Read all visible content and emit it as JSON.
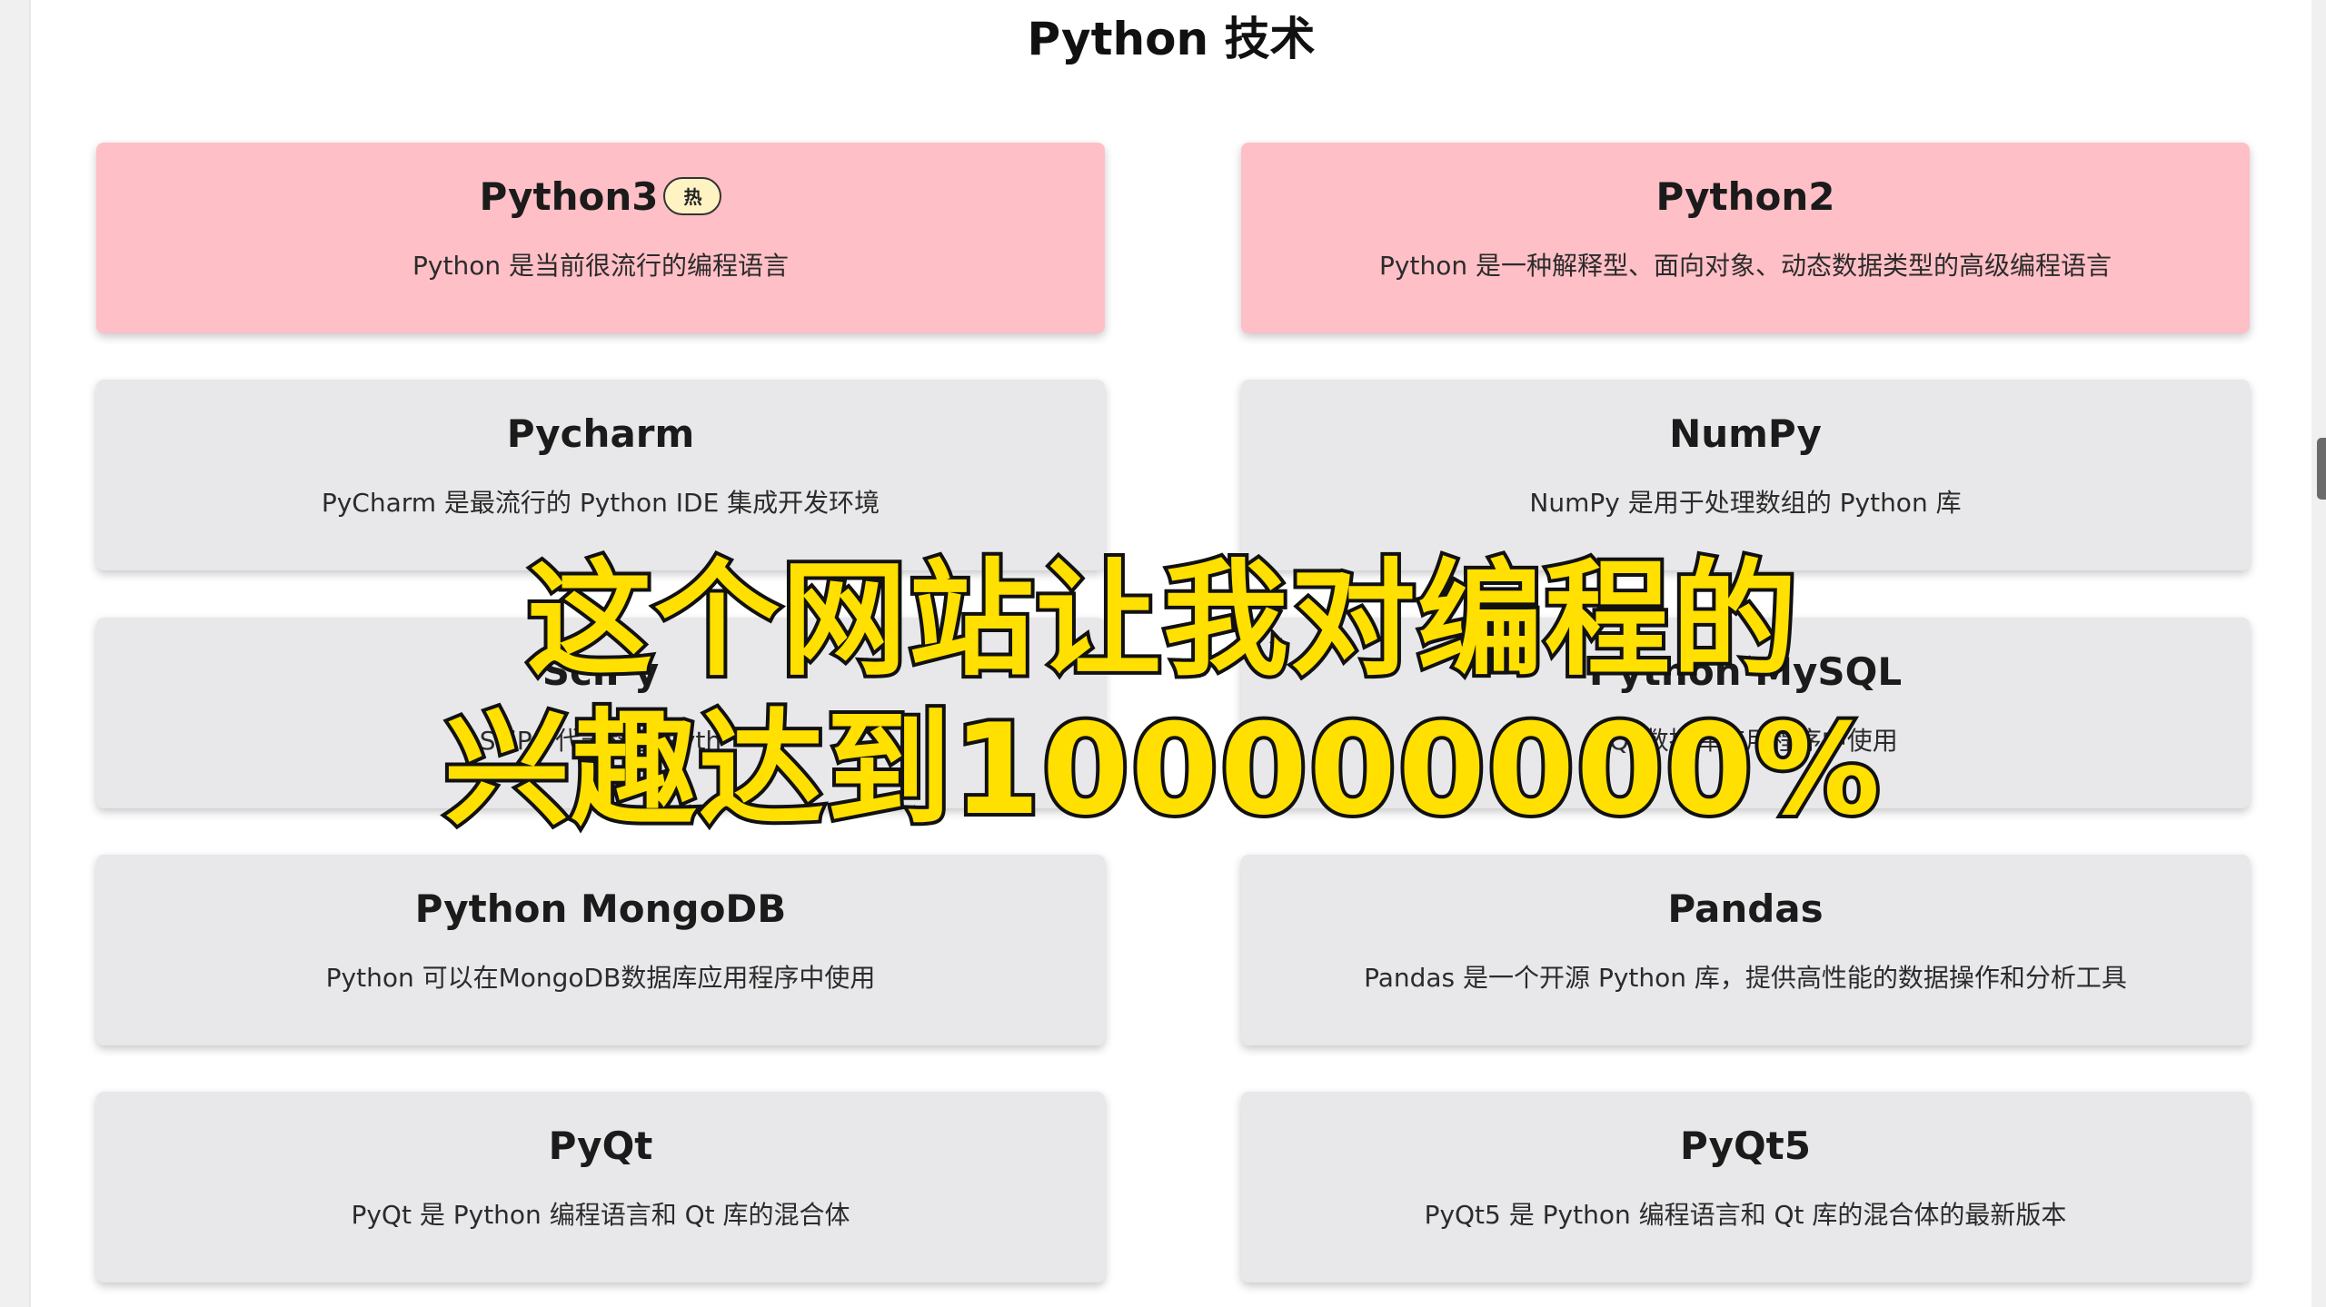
{
  "page": {
    "section_title": "Python 技术"
  },
  "cards": [
    {
      "title": "Python3",
      "badge": "热",
      "desc": "Python 是当前很流行的编程语言",
      "hot": true
    },
    {
      "title": "Python2",
      "desc": "Python 是一种解释型、面向对象、动态数据类型的高级编程语言",
      "hot": true
    },
    {
      "title": "Pycharm",
      "desc": "PyCharm 是最流行的 Python IDE 集成开发环境"
    },
    {
      "title": "NumPy",
      "desc": "NumPy 是用于处理数组的 Python 库"
    },
    {
      "title": "SciPy",
      "desc": "SciPy 代表科学 Pyth"
    },
    {
      "title": "Pytnon MySQL",
      "desc": "SQL数据库应用程序中使用"
    },
    {
      "title": "Python MongoDB",
      "desc": "Python 可以在MongoDB数据库应用程序中使用"
    },
    {
      "title": "Pandas",
      "desc": "Pandas 是一个开源 Python 库，提供高性能的数据操作和分析工具"
    },
    {
      "title": "PyQt",
      "desc": "PyQt 是 Python 编程语言和 Qt 库的混合体"
    },
    {
      "title": "PyQt5",
      "desc": "PyQt5 是 Python 编程语言和 Qt 库的混合体的最新版本"
    }
  ],
  "overlay": {
    "line1": "这个网站让我对编程的",
    "line2": "兴趣达到100000000%"
  },
  "colors": {
    "hot_card": "#ffbfc6",
    "normal_card": "#e8e8ea",
    "overlay_fill": "#ffe000",
    "overlay_stroke": "#111111"
  }
}
